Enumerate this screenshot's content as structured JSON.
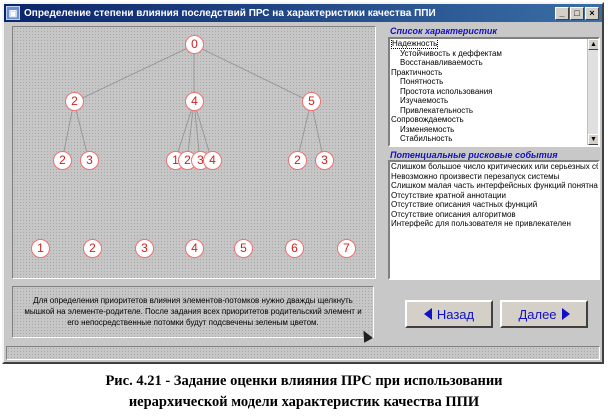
{
  "window": {
    "title": "Определение степени влияния последствий ПРС на характеристики качества ППИ",
    "app_icon": "app-icon",
    "buttons": [
      "_",
      "□",
      "×"
    ]
  },
  "tree": {
    "root": "0",
    "level1": [
      "2",
      "4",
      "5"
    ],
    "level2": [
      "2",
      "3",
      "1",
      "2",
      "3",
      "4",
      "2",
      "3"
    ],
    "bottom_row": [
      "1",
      "2",
      "3",
      "4",
      "5",
      "6",
      "7"
    ],
    "node_color": "#d02020"
  },
  "characteristics": {
    "label": "Список характеристик",
    "items": [
      {
        "text": "Надежность",
        "indent": false,
        "selected": true
      },
      {
        "text": "Устойчивость к деффектам",
        "indent": true
      },
      {
        "text": "Восстанавливаемость",
        "indent": true
      },
      {
        "text": "Практичность",
        "indent": false
      },
      {
        "text": "Понятность",
        "indent": true
      },
      {
        "text": "Простота использования",
        "indent": true
      },
      {
        "text": "Изучаемость",
        "indent": true
      },
      {
        "text": "Привлекательность",
        "indent": true
      },
      {
        "text": "Сопровождаемость",
        "indent": false
      },
      {
        "text": "Изменяемость",
        "indent": true
      },
      {
        "text": "Стабильность",
        "indent": true
      }
    ]
  },
  "risk_events": {
    "label": "Потенциальные рисковые события",
    "items": [
      "Слишком большое число критических или серьезных сбо",
      "Невозможно произвести перезапуск системы",
      "Слишком малая часть интерфейсных функций понятна",
      "Отсутствие кратной аннотации",
      "Отсутствие описания частных функций",
      "Отсутствие описания алгоритмов",
      "Интерфейс для пользователя не привлекателен"
    ]
  },
  "info": {
    "text": "Для определения приоритетов влияния элементов-потомков нужно дважды щелкнуть мышкой на элементе-родителе. После задания всех приоритетов родительский элемент и его непосредственные потомки будут подсвечены зеленым цветом."
  },
  "nav": {
    "back_label": "Назад",
    "next_label": "Далее",
    "accent": "#1010c8"
  },
  "caption": {
    "line1": "Рис. 4.21 - Задание оценки влияния ПРС при использовании",
    "line2": "иерархической модели характеристик качества ППИ"
  }
}
